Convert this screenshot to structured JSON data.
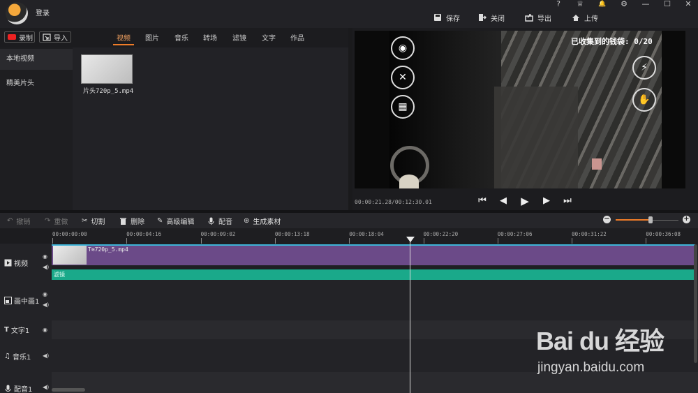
{
  "header": {
    "login": "登录",
    "window_controls": [
      "?",
      "♕",
      "🔔",
      "⚙",
      "—",
      "☐",
      "✕"
    ],
    "actions": [
      {
        "label": "保存",
        "icon": "save-icon"
      },
      {
        "label": "关闭",
        "icon": "exit-icon"
      },
      {
        "label": "导出",
        "icon": "export-icon"
      },
      {
        "label": "上传",
        "icon": "upload-icon"
      }
    ]
  },
  "toolbar": {
    "record": "录制",
    "import": "导入",
    "tabs": [
      "视频",
      "图片",
      "音乐",
      "转场",
      "滤镜",
      "文字",
      "作品"
    ],
    "active_tab": "视频"
  },
  "sidebar": {
    "items": [
      "本地视频",
      "精美片头"
    ]
  },
  "media": {
    "items": [
      {
        "name": "片头720p_5.mp4"
      }
    ]
  },
  "preview": {
    "overlay_counter": "已收集到的钱袋: 0/20",
    "time": "00:00:21.28/00:12:30.01",
    "controls": [
      "skip-start",
      "step-back",
      "play",
      "step-forward",
      "skip-end"
    ]
  },
  "edit_tools": [
    {
      "label": "撤销",
      "enabled": false
    },
    {
      "label": "重做",
      "enabled": false
    },
    {
      "label": "切割",
      "enabled": true
    },
    {
      "label": "删除",
      "enabled": true
    },
    {
      "label": "高级编辑",
      "enabled": true
    },
    {
      "label": "配音",
      "enabled": true
    },
    {
      "label": "生成素材",
      "enabled": true
    }
  ],
  "zoom": {
    "level_fraction": 0.55
  },
  "timeline": {
    "ticks": [
      "00:00:00:00",
      "00:00:04:16",
      "00:00:09:02",
      "00:00:13:18",
      "00:00:18:04",
      "00:00:22:20",
      "00:00:27:06",
      "00:00:31:22",
      "00:00:36:08"
    ],
    "tracks": [
      {
        "label": "视频",
        "icon": "video-track-icon"
      },
      {
        "label": "画中画1",
        "icon": "pip-track-icon"
      },
      {
        "label": "文字1",
        "icon": "text-track-icon"
      },
      {
        "label": "音乐1",
        "icon": "music-track-icon"
      },
      {
        "label": "配音1",
        "icon": "voice-track-icon"
      }
    ],
    "video_clip": "T≋720p_5.mp4",
    "filter_clip": "滤镜"
  },
  "watermark": {
    "logo": "Bai du 经验",
    "url": "jingyan.baidu.com"
  },
  "colors": {
    "accent": "#f07c28",
    "clip": "#6b4a88",
    "filter": "#1aa98a",
    "selection": "#3fb4d8"
  }
}
